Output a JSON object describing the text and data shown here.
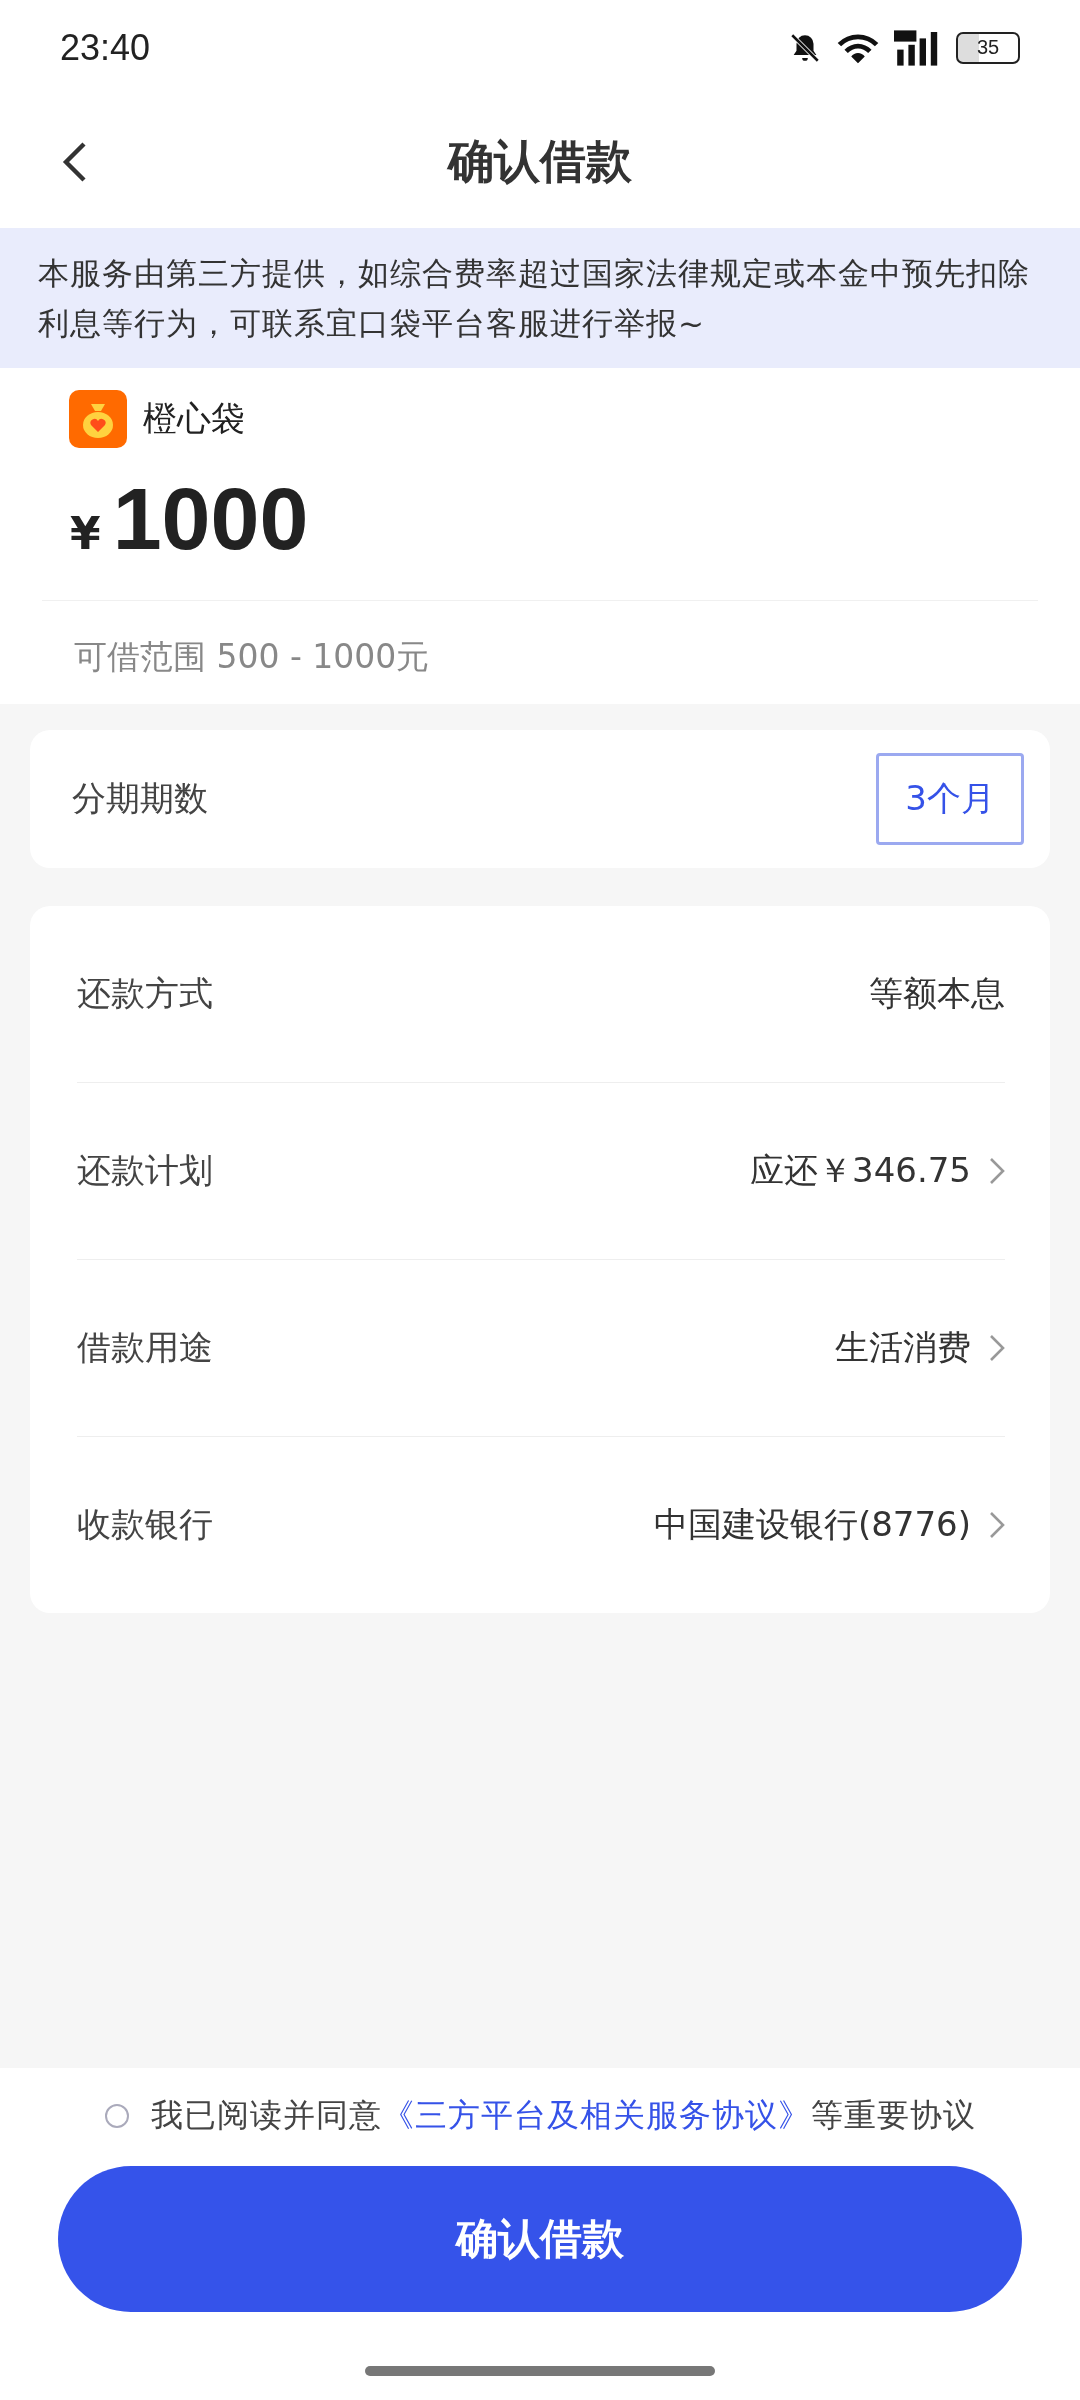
{
  "status_bar": {
    "time": "23:40",
    "battery": "35"
  },
  "header": {
    "title": "确认借款"
  },
  "notice": "本服务由第三方提供，如综合费率超过国家法律规定或本金中预先扣除利息等行为，可联系宜口袋平台客服进行举报~",
  "loan": {
    "brand": "橙心袋",
    "currency": "¥",
    "amount": "1000",
    "range": "可借范围 500 - 1000元"
  },
  "installments": {
    "label": "分期期数",
    "value": "3个月",
    "selected": true
  },
  "details": [
    {
      "kind": "static",
      "label": "还款方式",
      "value": "等额本息"
    },
    {
      "kind": "link",
      "label": "还款计划",
      "value": "应还￥346.75"
    },
    {
      "kind": "link",
      "label": "借款用途",
      "value": "生活消费"
    },
    {
      "kind": "link",
      "label": "收款银行",
      "value": "中国建设银行(8776)"
    }
  ],
  "agreement": {
    "checked": false,
    "prefix": "我已阅读并同意",
    "link": "《三方平台及相关服务协议》",
    "suffix": "等重要协议"
  },
  "confirm_button": "确认借款"
}
